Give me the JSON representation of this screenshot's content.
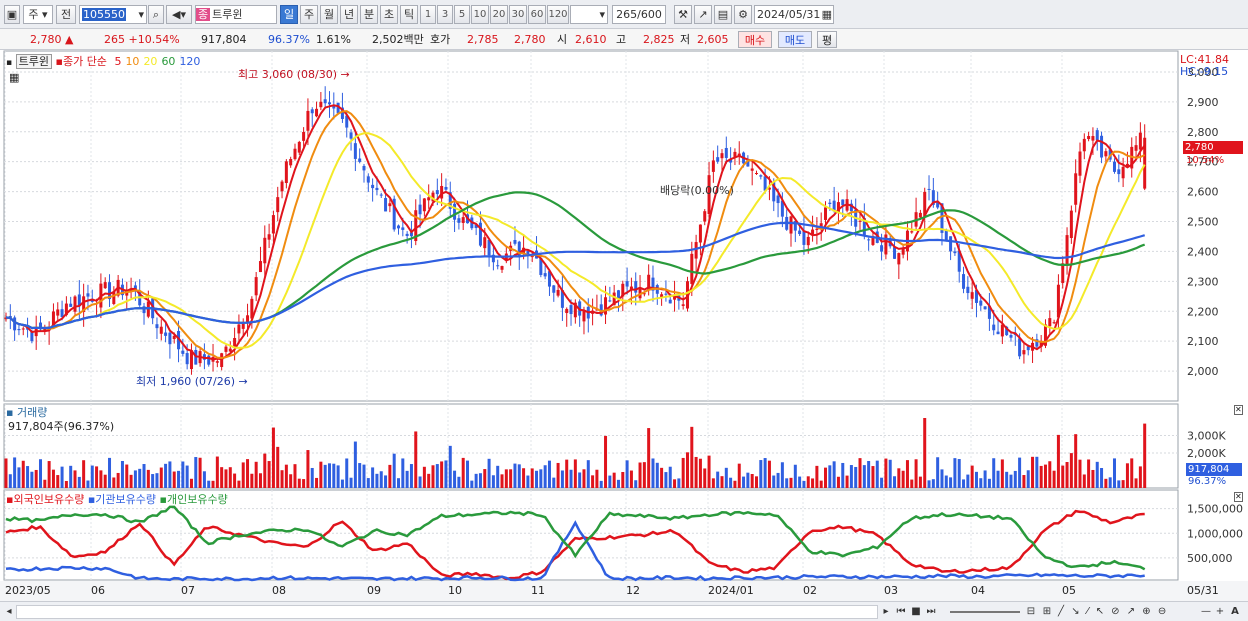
{
  "toolbar": {
    "code": "105550",
    "prev_label": "전",
    "stock_name": "트루윈",
    "type_badge": "종",
    "periods": [
      "일",
      "주",
      "월",
      "년",
      "분",
      "초",
      "틱"
    ],
    "intervals": [
      "1",
      "3",
      "5",
      "10",
      "20",
      "30",
      "60",
      "120"
    ],
    "count_value": "265",
    "count_total": "/600",
    "date": "2024/05/31",
    "week_label": "주"
  },
  "info": {
    "price": "2,780",
    "change": "265 +10.54%",
    "volume": "917,804",
    "volume_pct": "96.37%",
    "turnover": "1.61%",
    "amount": "2,502백만",
    "quote_label": "호가",
    "ask": "2,785",
    "bid": "2,780",
    "open_label": "시",
    "open": "2,610",
    "high_label": "고",
    "high": "2,825",
    "low_label": "저",
    "low": "2,605",
    "buy_label": "매수",
    "sell_label": "매도",
    "avg_label": "평"
  },
  "legend": {
    "name": "트루윈",
    "ma_label": "종가 단순",
    "ma_periods": [
      "5",
      "10",
      "20",
      "60",
      "120"
    ],
    "ma_colors": [
      "#e0141c",
      "#f08c10",
      "#f4ea2a",
      "#2a9a3c",
      "#2f5fe0"
    ],
    "lc": "LC:41.84",
    "hc": "HC:-9.15"
  },
  "annotations": {
    "high": "최고 3,060 (08/30)",
    "low": "최저 1,960 (07/26)",
    "dividend": "배당락(0.00%)"
  },
  "price_tag": {
    "price": "2,780",
    "pct": "10.54%"
  },
  "volume_panel": {
    "title": "거래량",
    "info": "917,804주(96.37%)",
    "tag_value": "917,804",
    "tag_pct": "96.37%"
  },
  "holdings_panel": {
    "labels": [
      "외국인보유수량",
      "기관보유수량",
      "개인보유수량"
    ],
    "colors": [
      "#e0141c",
      "#2f5fe0",
      "#2a9a3c"
    ]
  },
  "x_labels": [
    "2023/05",
    "06",
    "07",
    "08",
    "09",
    "10",
    "11",
    "12",
    "2024/01",
    "02",
    "03",
    "04",
    "05",
    "05/31"
  ],
  "chart_data": [
    {
      "type": "candlestick",
      "title": "트루윈",
      "y_ticks": [
        2000,
        2100,
        2200,
        2300,
        2400,
        2500,
        2600,
        2700,
        2800,
        2900,
        3000
      ],
      "ylim": [
        1900,
        3070
      ],
      "x_months": [
        "2023/05",
        "06",
        "07",
        "08",
        "09",
        "10",
        "11",
        "12",
        "2024/01",
        "02",
        "03",
        "04",
        "05"
      ],
      "close_path": [
        2180,
        2120,
        2230,
        2260,
        2280,
        2150,
        2040,
        2040,
        2250,
        2650,
        2900,
        2820,
        2600,
        2450,
        2620,
        2480,
        2380,
        2420,
        2240,
        2200,
        2260,
        2300,
        2230,
        2700,
        2700,
        2550,
        2420,
        2580,
        2460,
        2400,
        2600,
        2320,
        2180,
        2070,
        2160,
        2800,
        2670,
        2780
      ],
      "annotations": [
        "최고 3,060 (08/30)",
        "최저 1,960 (07/26)",
        "배당락(0.00%)"
      ],
      "moving_averages": [
        "5",
        "10",
        "20",
        "60",
        "120"
      ]
    },
    {
      "type": "bar",
      "title": "거래량",
      "y_ticks": [
        "2,000K",
        "3,000K"
      ],
      "last_value": "917,804",
      "last_pct": "96.37%"
    },
    {
      "type": "line",
      "series": [
        "외국인보유수량",
        "기관보유수량",
        "개인보유수량"
      ],
      "y_ticks": [
        "500,000",
        "1,000,000",
        "1,500,000"
      ]
    }
  ]
}
